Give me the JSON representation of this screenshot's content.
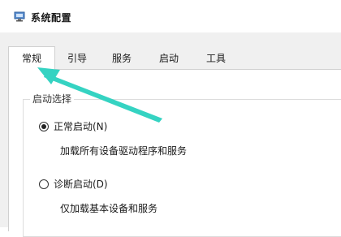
{
  "window": {
    "title": "系统配置",
    "icon": "system-config-icon"
  },
  "tabs": [
    {
      "label": "常规",
      "active": true
    },
    {
      "label": "引导",
      "active": false
    },
    {
      "label": "服务",
      "active": false
    },
    {
      "label": "启动",
      "active": false
    },
    {
      "label": "工具",
      "active": false
    }
  ],
  "startup_group": {
    "legend": "启动选择",
    "options": [
      {
        "label": "正常启动(N)",
        "description": "加载所有设备驱动程序和服务",
        "selected": true
      },
      {
        "label": "诊断启动(D)",
        "description": "仅加载基本设备和服务",
        "selected": false
      }
    ]
  },
  "annotation": {
    "type": "arrow",
    "color": "#35d3c2"
  }
}
